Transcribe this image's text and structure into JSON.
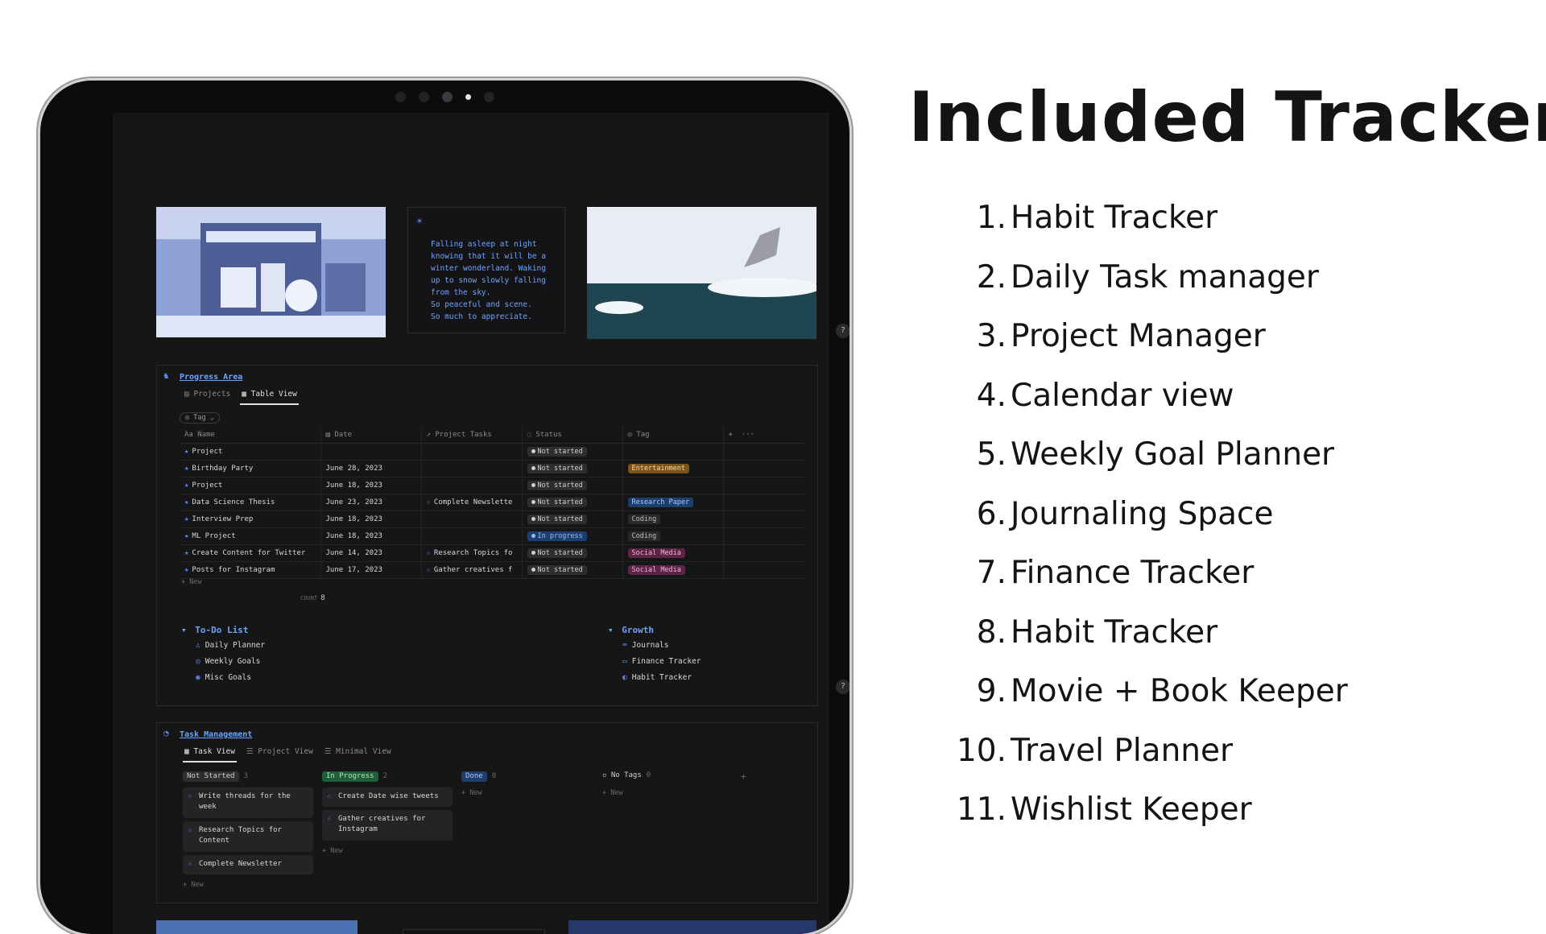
{
  "heading": "Included Trackers",
  "trackers": [
    {
      "num": "1.",
      "name": "Habit Tracker"
    },
    {
      "num": "2.",
      "name": "Daily Task manager"
    },
    {
      "num": "3.",
      "name": "Project Manager"
    },
    {
      "num": "4.",
      "name": "Calendar view"
    },
    {
      "num": "5.",
      "name": "Weekly Goal Planner"
    },
    {
      "num": "6.",
      "name": "Journaling Space"
    },
    {
      "num": "7.",
      "name": "Finance Tracker"
    },
    {
      "num": "8.",
      "name": "Habit Tracker"
    },
    {
      "num": "9.",
      "name": "Movie + Book Keeper"
    },
    {
      "num": "10.",
      "name": "Travel Planner"
    },
    {
      "num": "11.",
      "name": "Wishlist Keeper"
    }
  ],
  "quote": "Falling asleep at night\nknowing that it will be a\nwinter wonderland. Waking\nup to snow slowly falling\nfrom the sky.\nSo peaceful and scene.\nSo much to appreciate.",
  "help_label": "?",
  "progress": {
    "title": "Progress Area",
    "tabs": [
      "Projects",
      "Table View"
    ],
    "filter_label": "Tag",
    "columns": [
      "Aa Name",
      "Date",
      "Project Tasks",
      "Status",
      "Tag"
    ],
    "add_label": "+",
    "more_label": "···",
    "rows": [
      {
        "name": "Project",
        "date": "",
        "task": "",
        "status": "Not started",
        "tag": ""
      },
      {
        "name": "Birthday Party",
        "date": "June 28, 2023",
        "task": "",
        "status": "Not started",
        "tag": "Entertainment"
      },
      {
        "name": "Project",
        "date": "June 18, 2023",
        "task": "",
        "status": "Not started",
        "tag": ""
      },
      {
        "name": "Data Science Thesis",
        "date": "June 23, 2023",
        "task": "Complete Newslette",
        "status": "Not started",
        "tag": "Research Paper"
      },
      {
        "name": "Interview Prep",
        "date": "June 18, 2023",
        "task": "",
        "status": "Not started",
        "tag": "Coding"
      },
      {
        "name": "ML Project",
        "date": "June 18, 2023",
        "task": "",
        "status": "In progress",
        "tag": "Coding"
      },
      {
        "name": "Create Content for Twitter",
        "date": "June 14, 2023",
        "task": "Research Topics fo",
        "status": "Not started",
        "tag": "Social Media"
      },
      {
        "name": "Posts for Instagram",
        "date": "June 17, 2023",
        "task": "Gather creatives f",
        "status": "Not started",
        "tag": "Social Media"
      }
    ],
    "new_label": "+ New",
    "count_label": "COUNT",
    "count_value": "8",
    "todo": {
      "title": "To-Do List",
      "items": [
        "Daily Planner",
        "Weekly Goals",
        "Misc Goals"
      ]
    },
    "growth": {
      "title": "Growth",
      "items": [
        "Journals",
        "Finance Tracker",
        "Habit Tracker"
      ]
    }
  },
  "tasks": {
    "title": "Task Management",
    "tabs": [
      "Task View",
      "Project View",
      "Minimal View"
    ],
    "columns": [
      {
        "label": "Not Started",
        "count": "3",
        "cards": [
          "Write threads for the week",
          "Research Topics for Content",
          "Complete Newsletter"
        ]
      },
      {
        "label": "In Progress",
        "count": "2",
        "cards": [
          "Create Date wise tweets",
          "Gather creatives for Instagram"
        ]
      },
      {
        "label": "Done",
        "count": "0",
        "cards": []
      },
      {
        "label": "No Tags",
        "count": "0",
        "cards": []
      }
    ],
    "new_label": "+ New",
    "add_label": "+"
  },
  "colors": {
    "accent_blue": "#6ea4ff",
    "screen_bg": "#161617",
    "status_in_progress": "#1f3e6b",
    "tag_entertainment": "#7a5418",
    "tag_social": "#5e2446",
    "column_in_progress": "#1f5e36"
  }
}
